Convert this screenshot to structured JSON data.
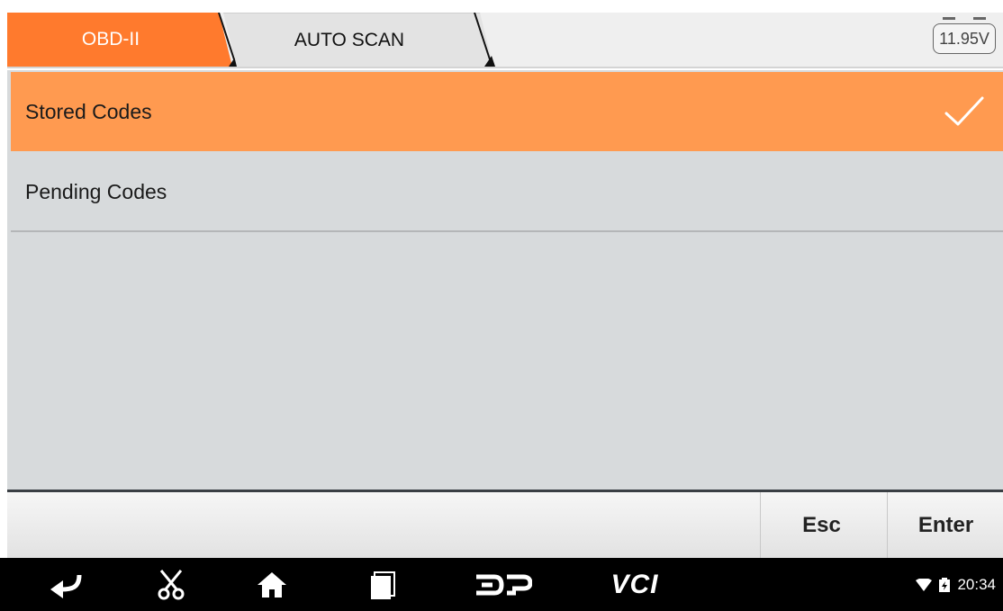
{
  "tabs": [
    {
      "label": "OBD-II",
      "active": true
    },
    {
      "label": "AUTO SCAN",
      "active": false
    }
  ],
  "battery": {
    "voltage": "11.95V"
  },
  "menu": {
    "items": [
      {
        "label": "Stored Codes",
        "selected": true
      },
      {
        "label": "Pending Codes",
        "selected": false
      }
    ]
  },
  "actions": {
    "esc_label": "Esc",
    "enter_label": "Enter"
  },
  "navbar": {
    "icons": [
      "back-icon",
      "scissors-icon",
      "home-icon",
      "recent-apps-icon",
      "dp-icon",
      "vci-icon"
    ],
    "vci_label": "VCI",
    "time": "20:34",
    "status_icons": [
      "wifi-icon",
      "battery-icon"
    ]
  },
  "colors": {
    "accent": "#ff7a2d",
    "selected_row": "#ff9a50",
    "list_background": "#d7dadc",
    "navbar": "#000000"
  }
}
